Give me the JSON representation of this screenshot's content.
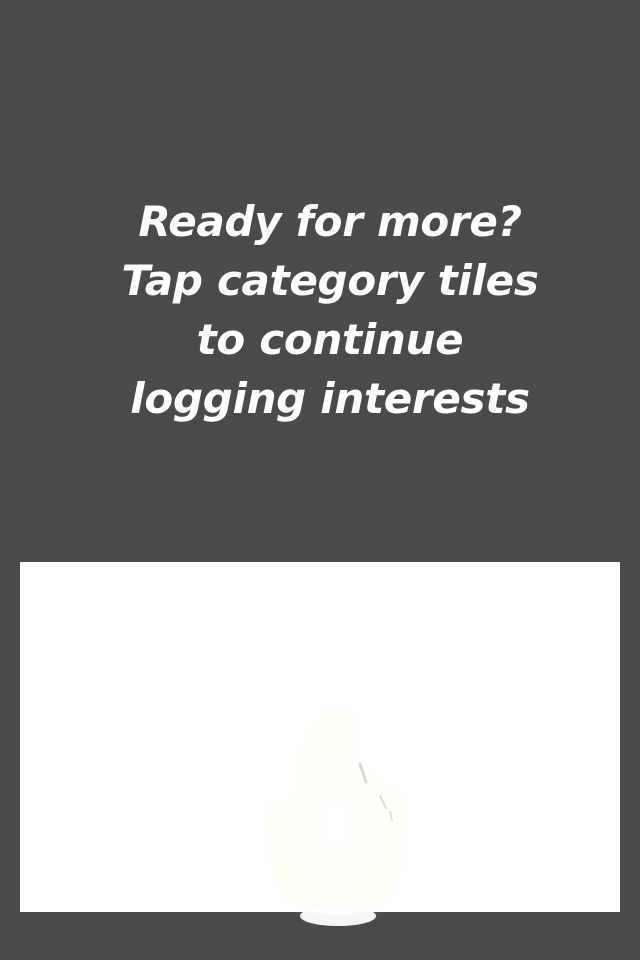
{
  "coach_mark": {
    "lines": [
      "Ready for more?",
      "Tap category tiles",
      "to continue",
      "logging interests"
    ]
  },
  "hand_icon": "pointing-hand-icon",
  "colors": {
    "overlay": "#4a4a4a",
    "text": "#ffffff",
    "highlight": "#ffffff",
    "hand_glow": "#fffbe6"
  }
}
